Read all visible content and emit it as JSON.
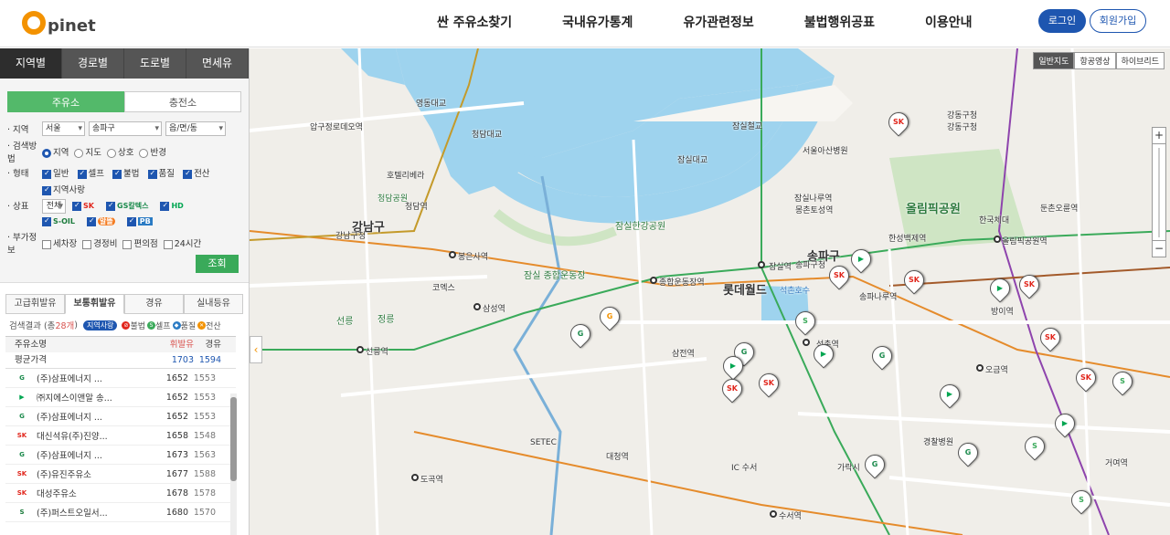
{
  "header": {
    "logo_text": "pinet",
    "nav": [
      "싼 주유소찾기",
      "국내유가통계",
      "유가관련정보",
      "불법행위공표",
      "이용안내"
    ],
    "login": "로그인",
    "join": "회원가입"
  },
  "search_tabs": [
    "지역별",
    "경로별",
    "도로별",
    "면세유"
  ],
  "station_types": [
    "주유소",
    "충전소"
  ],
  "filters": {
    "region_label": "지역",
    "region_values": [
      "서울",
      "송파구",
      "읍/면/동"
    ],
    "method_label": "검색방법",
    "method_options": [
      "지역",
      "지도",
      "상호",
      "반경"
    ],
    "form_label": "형태",
    "form_options": [
      "일반",
      "셀프",
      "불법",
      "품질",
      "전산",
      "지역사랑"
    ],
    "brand_label": "상표",
    "brand_all": "전체",
    "brands": [
      "SK",
      "GS칼텍스",
      "HD",
      "S-OIL",
      "알뜰",
      "PB"
    ],
    "extra_label": "부가정보",
    "extra_options": [
      "세차장",
      "경정비",
      "편의점",
      "24시간"
    ],
    "search_button": "조회"
  },
  "price_tabs": [
    "고급휘발유",
    "보통휘발유",
    "경유",
    "실내등유"
  ],
  "result": {
    "prefix": "검색결과 (총 ",
    "count": "28개",
    "suffix": ")",
    "legend_pill": "지역사랑",
    "legend_items": [
      "불법",
      "셀프",
      "품질",
      "전산"
    ]
  },
  "list": {
    "col_name": "주유소명",
    "col_gas": "휘발유",
    "col_diesel": "경유",
    "avg_label": "평균가격",
    "avg_gas": "1703",
    "avg_diesel": "1594",
    "rows": [
      {
        "brand": "GS",
        "name": "(주)삼표에너지 ...",
        "gas": "1652",
        "diesel": "1553"
      },
      {
        "brand": "HD",
        "name": "㈜지에스이앤알 송...",
        "gas": "1652",
        "diesel": "1553"
      },
      {
        "brand": "GS",
        "name": "(주)삼표에너지 ...",
        "gas": "1652",
        "diesel": "1553"
      },
      {
        "brand": "SK",
        "name": "대신석유(주)진양...",
        "gas": "1658",
        "diesel": "1548"
      },
      {
        "brand": "GS",
        "name": "(주)삼표에너지 ...",
        "gas": "1673",
        "diesel": "1563"
      },
      {
        "brand": "SK",
        "name": "(주)유진주유소",
        "gas": "1677",
        "diesel": "1588"
      },
      {
        "brand": "SK",
        "name": "대성주유소",
        "gas": "1678",
        "diesel": "1578"
      },
      {
        "brand": "SOIL",
        "name": "(주)퍼스트오일서...",
        "gas": "1680",
        "diesel": "1570"
      }
    ]
  },
  "map": {
    "map_types": [
      "일반지도",
      "항공영상",
      "하이브리드"
    ],
    "labels": {
      "gangnam_gu": "강남구",
      "songpa_gu": "송파구",
      "lotte": "롯데월드",
      "olympic_park": "올림픽공원",
      "jamsil_sports": "잠실 종합운동장",
      "seokchon_lake": "석촌호수",
      "jamsil_bridge": "잠실대교",
      "jamsil_railway": "잠실철교",
      "cheongdam_bridge": "청담대교",
      "yeongdong_bridge": "영동대교",
      "jamsil_hangang": "잠실한강공원",
      "seolleung": "선릉",
      "jeongneung": "정릉",
      "coex": "코엑스",
      "setec": "SETEC",
      "seoul_asan": "서울아산병원",
      "korea_sports": "한국체대",
      "garak": "가락시",
      "ic_suseo": "IC 수서",
      "cheongdam_park": "청담공원",
      "gangdong_gu": "강동구청",
      "hotel": "호텔리베라"
    },
    "stations": {
      "st_jamsil": "잠실역",
      "st_songpa_office": "송파구청",
      "st_jamsilnaru": "잠실나루역",
      "st_seokchon": "석촌역",
      "st_samjeon": "삼전역",
      "st_sports": "종합운동장역",
      "st_samseong": "삼성역",
      "st_seolleung": "선릉역",
      "st_bongeunsa": "봉은사역",
      "st_cheongdam": "청담역",
      "st_gangnam_office": "강남구청",
      "st_apgujeong": "압구정로데오역",
      "st_dogok": "도곡역",
      "st_daecheong": "대청역",
      "st_suseo": "수서역",
      "st_olympic": "올림픽공원역",
      "st_ogeum": "오금역",
      "st_songpanaru": "송파나루역",
      "st_hanseong": "한성백제역",
      "st_mongchon": "몽촌토성역",
      "st_gangdong": "강동구청",
      "st_dunchon": "둔촌오륜역",
      "st_bangi": "방이역",
      "st_geoyeo": "거여역",
      "st_gyeongchal": "경찰병원"
    }
  },
  "colors": {
    "brand_orange": "#f39200",
    "primary_blue": "#1e56b0",
    "search_green": "#3aaa5a",
    "river": "#9ed3ee",
    "park": "#cfe5c4"
  }
}
